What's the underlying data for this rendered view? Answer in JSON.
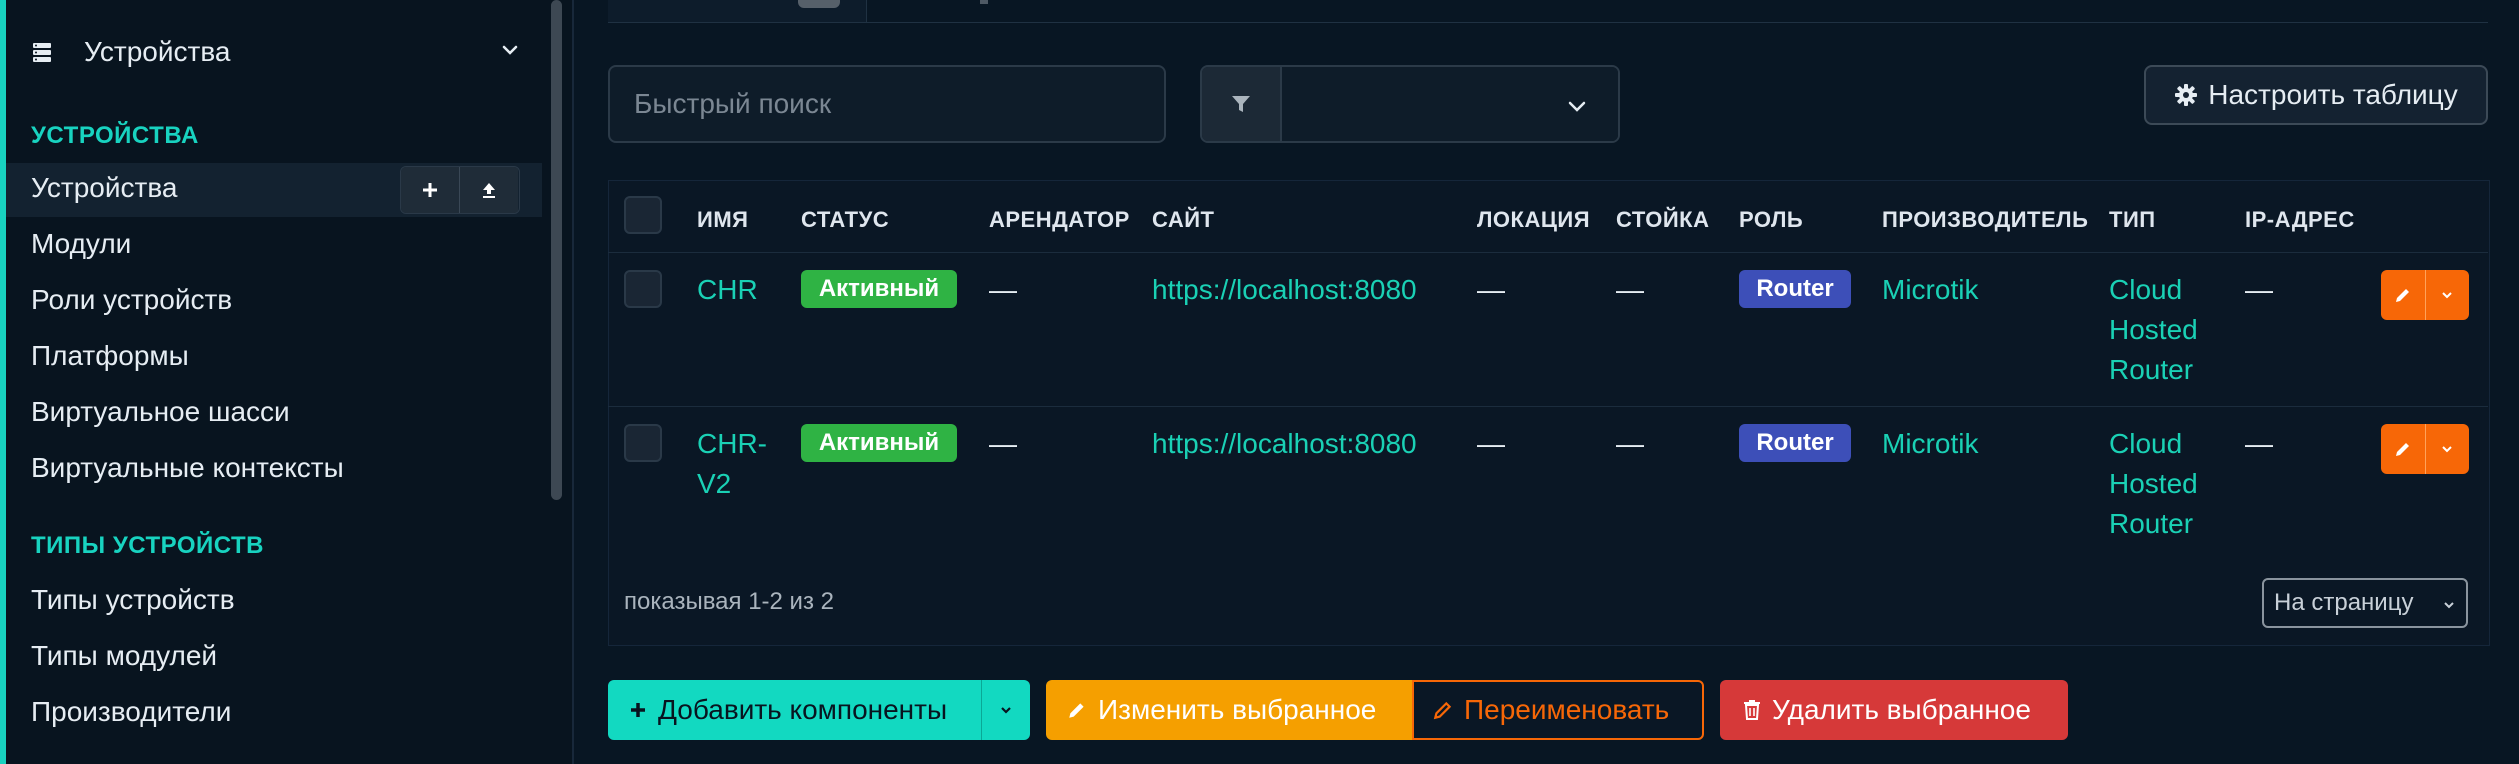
{
  "sidebar": {
    "group_label": "Устройства",
    "section1_title": "УСТРОЙСТВА",
    "section1_items": [
      "Устройства",
      "Модули",
      "Роли устройств",
      "Платформы",
      "Виртуальное шасси",
      "Виртуальные контексты"
    ],
    "section2_title": "ТИПЫ УСТРОЙСТВ",
    "section2_items": [
      "Типы устройств",
      "Типы модулей",
      "Производители"
    ]
  },
  "toolbar": {
    "search_placeholder": "Быстрый поиск",
    "filter_value": "",
    "configure_label": "Настроить таблицу"
  },
  "table": {
    "headers": {
      "name": "ИМЯ",
      "status": "СТАТУС",
      "tenant": "АРЕНДАТОР",
      "site": "САЙТ",
      "location": "ЛОКАЦИЯ",
      "rack": "СТОЙКА",
      "role": "РОЛЬ",
      "manufacturer": "ПРОИЗВОДИТЕЛЬ",
      "type": "ТИП",
      "ip": "IP-АДРЕС"
    },
    "rows": [
      {
        "name": "CHR",
        "status": "Активный",
        "tenant": "—",
        "site": "https://localhost:8080",
        "location": "—",
        "rack": "—",
        "role": "Router",
        "manufacturer": "Microtik",
        "type_lines": [
          "Cloud",
          "Hosted",
          "Router"
        ],
        "ip": "—"
      },
      {
        "name_lines": [
          "CHR-",
          "V2"
        ],
        "status": "Активный",
        "tenant": "—",
        "site": "https://localhost:8080",
        "location": "—",
        "rack": "—",
        "role": "Router",
        "manufacturer": "Microtik",
        "type_lines": [
          "Cloud",
          "Hosted",
          "Router"
        ],
        "ip": "—"
      }
    ],
    "footer": "показывая 1-2 из 2",
    "per_page_label": "На страницу"
  },
  "actions": {
    "add": "Добавить компоненты",
    "edit": "Изменить выбранное",
    "rename": "Переименовать",
    "delete": "Удалить выбранное"
  },
  "colors": {
    "accent": "#18d3c0",
    "active_badge": "#2fb344",
    "role_badge": "#3d4fb8",
    "edit_orange": "#f76707",
    "bulk_edit": "#f59f00",
    "delete_red": "#d63939"
  }
}
